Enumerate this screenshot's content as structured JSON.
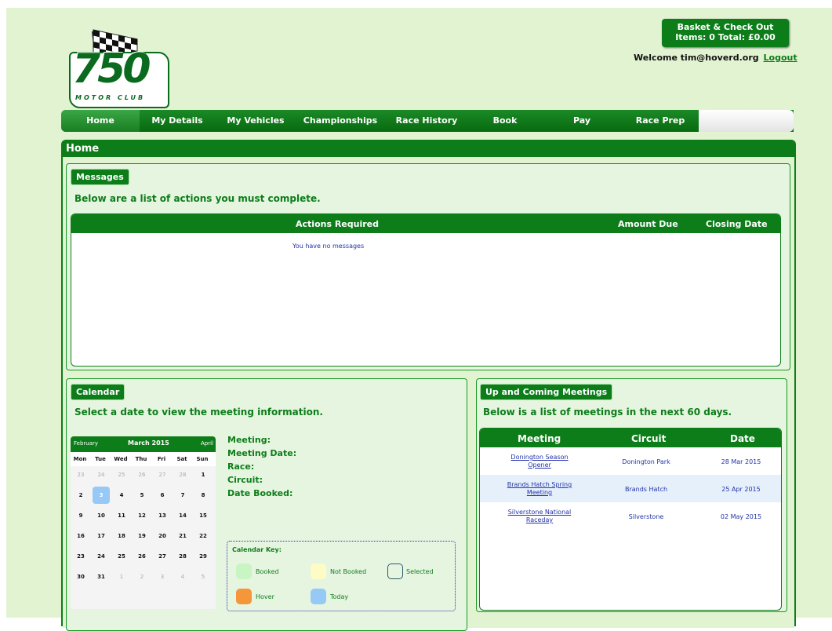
{
  "logo": {
    "number": "750",
    "subtitle": "MOTOR CLUB"
  },
  "basket": {
    "line1": "Basket & Check Out",
    "line2": "Items: 0 Total: £0.00"
  },
  "user": {
    "welcome": "Welcome tim@hoverd.org",
    "logout_label": "Logout"
  },
  "nav": {
    "items": [
      {
        "label": "Home"
      },
      {
        "label": "My Details"
      },
      {
        "label": "My Vehicles"
      },
      {
        "label": "Championships"
      },
      {
        "label": "Race History"
      },
      {
        "label": "Book"
      },
      {
        "label": "Pay"
      },
      {
        "label": "Race Prep"
      }
    ]
  },
  "page": {
    "title": "Home"
  },
  "messages": {
    "tag": "Messages",
    "subtitle": "Below are a list of actions you must complete.",
    "columns": [
      "Actions Required",
      "Amount Due",
      "Closing Date"
    ],
    "empty_text": "You have no messages"
  },
  "calendar": {
    "tag": "Calendar",
    "subtitle": "Select a date to view the meeting information.",
    "prev_month": "February",
    "month": "March 2015",
    "next_month": "April",
    "day_names": [
      "Mon",
      "Tue",
      "Wed",
      "Thu",
      "Fri",
      "Sat",
      "Sun"
    ],
    "weeks": [
      [
        "23",
        "24",
        "25",
        "26",
        "27",
        "28",
        "1"
      ],
      [
        "2",
        "3",
        "4",
        "5",
        "6",
        "7",
        "8"
      ],
      [
        "9",
        "10",
        "11",
        "12",
        "13",
        "14",
        "15"
      ],
      [
        "16",
        "17",
        "18",
        "19",
        "20",
        "21",
        "22"
      ],
      [
        "23",
        "24",
        "25",
        "26",
        "27",
        "28",
        "29"
      ],
      [
        "30",
        "31",
        "1",
        "2",
        "3",
        "4",
        "5"
      ]
    ],
    "info_labels": [
      "Meeting:",
      "Meeting Date:",
      "Race:",
      "Circuit:",
      "Date Booked:"
    ],
    "key": {
      "title": "Calendar Key:",
      "items": [
        {
          "label": "Booked",
          "color": "#c9f5c4"
        },
        {
          "label": "Not Booked",
          "color": "#fefcc6"
        },
        {
          "label": "Selected",
          "color": "#e6f5e0"
        },
        {
          "label": "Hover",
          "color": "#f5963a"
        },
        {
          "label": "Today",
          "color": "#96c9f6"
        }
      ]
    }
  },
  "meetings": {
    "tag": "Up and Coming Meetings",
    "subtitle": "Below is a list of meetings in the next 60 days.",
    "columns": [
      "Meeting",
      "Circuit",
      "Date"
    ],
    "rows": [
      {
        "meeting_line1": "Donington Season",
        "meeting_line2": "Opener",
        "circuit": "Donington Park",
        "date": "28 Mar 2015"
      },
      {
        "meeting_line1": "Brands Hatch Spring",
        "meeting_line2": "Meeting",
        "circuit": "Brands Hatch",
        "date": "25 Apr 2015"
      },
      {
        "meeting_line1": "Silverstone National",
        "meeting_line2": "Raceday",
        "circuit": "Silverstone",
        "date": "02 May 2015"
      }
    ]
  },
  "colors": {
    "brand_green": "#0d7d1a",
    "page_bg": "#e2f3d2",
    "link_blue": "#2233aa"
  }
}
